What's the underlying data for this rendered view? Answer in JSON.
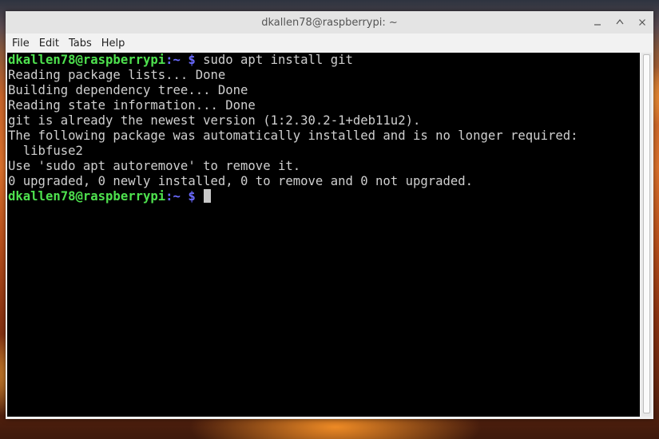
{
  "window": {
    "title": "dkallen78@raspberrypi: ~",
    "controls": {
      "minimize": "minimize-icon",
      "maximize": "maximize-icon",
      "close": "close-icon"
    }
  },
  "menubar": [
    "File",
    "Edit",
    "Tabs",
    "Help"
  ],
  "prompt": {
    "user_host": "dkallen78@raspberrypi",
    "colon": ":",
    "path": "~ $",
    "command": " sudo apt install git"
  },
  "output": [
    "Reading package lists... Done",
    "Building dependency tree... Done",
    "Reading state information... Done",
    "git is already the newest version (1:2.30.2-1+deb11u2).",
    "The following package was automatically installed and is no longer required:",
    "  libfuse2",
    "Use 'sudo apt autoremove' to remove it.",
    "0 upgraded, 0 newly installed, 0 to remove and 0 not upgraded."
  ],
  "colors": {
    "prompt_user": "#4ee14e",
    "prompt_path": "#6a6aff",
    "text": "#cfcfcf",
    "background": "#000000"
  }
}
